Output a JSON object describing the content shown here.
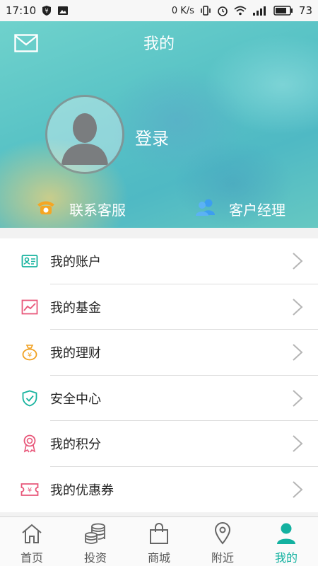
{
  "status_bar": {
    "time": "17:10",
    "net_speed": "0 K/s",
    "battery": "73"
  },
  "header": {
    "title": "我的",
    "login_label": "登录",
    "quick_links": [
      {
        "label": "联系客服",
        "icon": "phone-icon",
        "color": "#f5a623"
      },
      {
        "label": "客户经理",
        "icon": "users-icon",
        "color": "#3d9ef0"
      }
    ]
  },
  "menu": {
    "items": [
      {
        "label": "我的账户",
        "icon": "account-card-icon",
        "color": "#16b39e"
      },
      {
        "label": "我的基金",
        "icon": "chart-line-icon",
        "color": "#e8577a"
      },
      {
        "label": "我的理财",
        "icon": "money-bag-icon",
        "color": "#f0a020"
      },
      {
        "label": "安全中心",
        "icon": "shield-check-icon",
        "color": "#16b39e"
      },
      {
        "label": "我的积分",
        "icon": "medal-icon",
        "color": "#e8577a"
      },
      {
        "label": "我的优惠券",
        "icon": "coupon-icon",
        "color": "#e8577a"
      }
    ]
  },
  "bottom_nav": {
    "items": [
      {
        "label": "首页",
        "icon": "home-icon"
      },
      {
        "label": "投资",
        "icon": "coins-icon"
      },
      {
        "label": "商城",
        "icon": "shopping-bag-icon"
      },
      {
        "label": "附近",
        "icon": "location-pin-icon"
      },
      {
        "label": "我的",
        "icon": "profile-icon"
      }
    ],
    "active_index": 4,
    "active_color": "#13b1a0"
  }
}
